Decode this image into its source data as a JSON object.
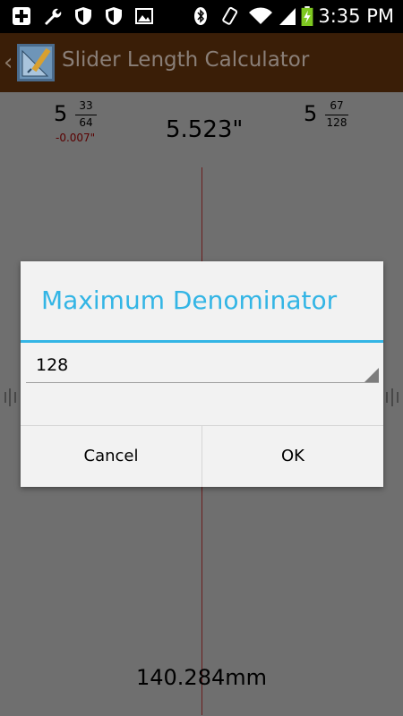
{
  "status_bar": {
    "time": "3:35 PM",
    "icons": [
      "add-icon",
      "wrench-icon",
      "shield-icon",
      "shield-icon",
      "image-icon",
      "bluetooth-icon",
      "vibrate-icon",
      "wifi-icon",
      "signal-icon",
      "battery-charging-icon"
    ]
  },
  "action_bar": {
    "title": "Slider Length Calculator",
    "back_glyph": "‹",
    "app_icon": "ruler-pencil-icon"
  },
  "measurement": {
    "left_fraction": {
      "whole": "5",
      "numerator": "33",
      "denominator": "64"
    },
    "left_error": "-0.007\"",
    "decimal": "5.523\"",
    "right_fraction": {
      "whole": "5",
      "numerator": "67",
      "denominator": "128"
    },
    "millimeters": "140.284mm"
  },
  "dialog": {
    "title": "Maximum Denominator",
    "selected_value": "128",
    "cancel_label": "Cancel",
    "ok_label": "OK"
  },
  "colors": {
    "accent": "#33b5e5",
    "action_bar": "#3a1e07",
    "indicator_line": "#6a1e1e"
  }
}
